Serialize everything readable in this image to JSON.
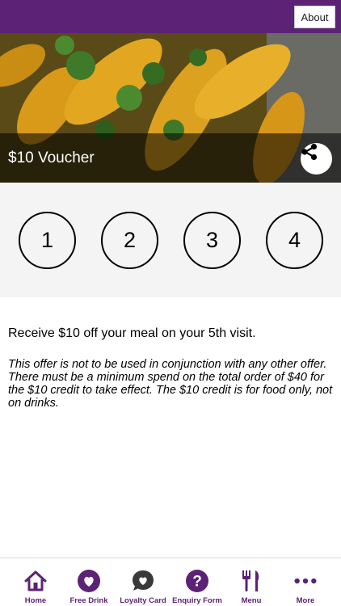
{
  "header": {
    "about_label": "About",
    "accent_color": "#5c2275"
  },
  "hero": {
    "title": "$10 Voucher",
    "share_icon": "share-icon"
  },
  "stamps": [
    "1",
    "2",
    "3",
    "4"
  ],
  "offer": {
    "headline": "Receive $10 off your meal on your 5th visit.",
    "terms": "This offer is not to be used in conjunction with any other offer. There must be a minimum spend on the total order of $40 for the $10 credit to take effect. The $10 credit is for food only, not on drinks."
  },
  "tabbar": {
    "items": [
      {
        "label": "Home",
        "icon": "home-icon"
      },
      {
        "label": "Free Drink",
        "icon": "heart-icon"
      },
      {
        "label": "Loyalty Card",
        "icon": "heart-bubble-icon"
      },
      {
        "label": "Enquiry Form",
        "icon": "question-icon"
      },
      {
        "label": "Menu",
        "icon": "fork-knife-icon"
      },
      {
        "label": "More",
        "icon": "more-icon"
      }
    ]
  }
}
